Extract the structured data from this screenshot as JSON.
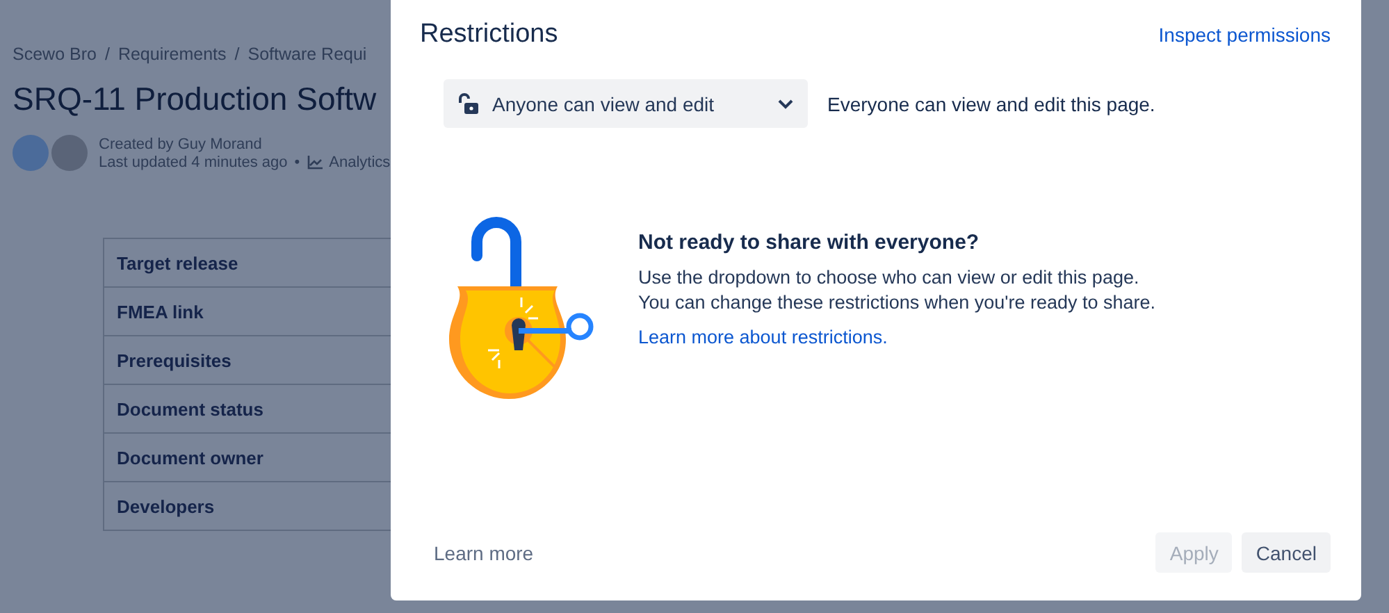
{
  "page": {
    "breadcrumbs": [
      "Scewo Bro",
      "Requirements",
      "Software Requi"
    ],
    "breadcrumb_separators": [
      "/",
      "/"
    ],
    "meta_separator": "•",
    "title": "SRQ-11 Production Softw",
    "created_by": "Created by Guy Morand",
    "last_updated": "Last updated 4 minutes ago",
    "analytics": "Analytics",
    "table_rows": [
      "Target release",
      "FMEA link",
      "Prerequisites",
      "Document status",
      "Document owner",
      "Developers"
    ]
  },
  "dialog": {
    "title": "Restrictions",
    "inspect_link": "Inspect permissions",
    "dropdown": {
      "value": "Anyone can view and edit"
    },
    "dropdown_description": "Everyone can view and edit this page.",
    "empty_state": {
      "heading": "Not ready to share with everyone?",
      "body": "Use the dropdown to choose who can view or edit this page. You can change these restrictions when you're ready to share.",
      "link": "Learn more about restrictions."
    },
    "footer_link": "Learn more",
    "buttons": [
      {
        "label": "Apply",
        "disabled": true
      },
      {
        "label": "Cancel",
        "disabled": false
      }
    ]
  }
}
